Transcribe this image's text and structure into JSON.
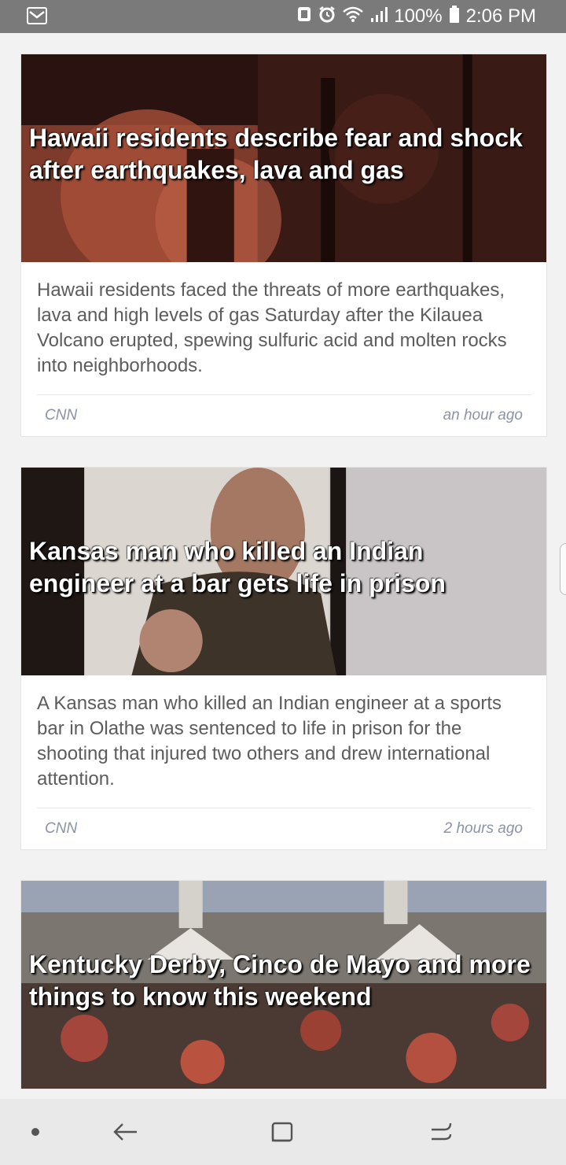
{
  "status_bar": {
    "battery": "100%",
    "time": "2:06 PM"
  },
  "articles": [
    {
      "headline": "Hawaii residents describe fear and shock after earthquakes, lava and gas",
      "summary": "Hawaii residents faced the threats of more earthquakes, lava and high levels of gas Saturday after the Kilauea Volcano erupted, spewing sulfuric acid and molten rocks into neighborhoods.",
      "source": "CNN",
      "time": "an hour ago"
    },
    {
      "headline": "Kansas man who killed an Indian engineer at a bar gets life in prison",
      "summary": "A Kansas man who killed an Indian engineer at a sports bar in Olathe was sentenced to life in prison for the shooting that injured two others and drew international attention.",
      "source": "CNN",
      "time": "2 hours ago"
    },
    {
      "headline": "Kentucky Derby, Cinco de Mayo and more things to know this weekend",
      "summary": "",
      "source": "",
      "time": ""
    }
  ],
  "icons": {
    "status_left": "gmail-icon",
    "status_right": [
      "nfc-icon",
      "alarm-icon",
      "wifi-icon",
      "signal-icon",
      "battery-icon"
    ],
    "navigation": [
      "nav-dot-icon",
      "back-icon",
      "recents-icon",
      "menu-icon"
    ]
  }
}
